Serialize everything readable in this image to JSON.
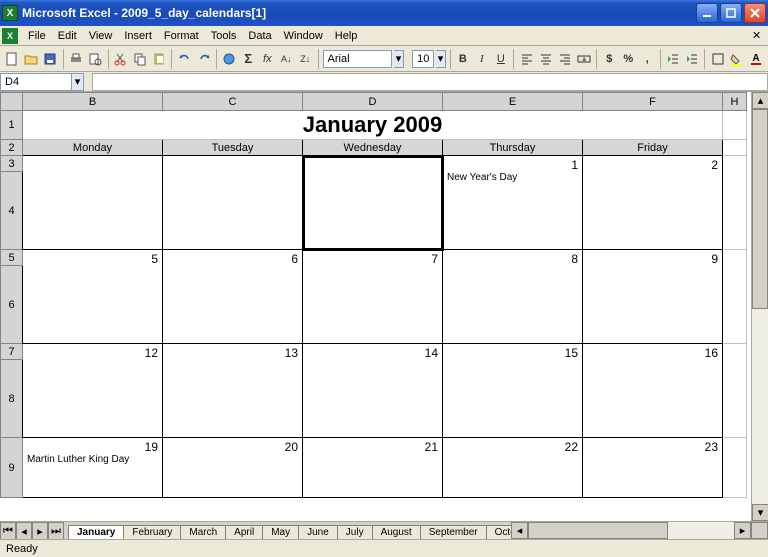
{
  "window": {
    "app_name": "Microsoft Excel",
    "doc_name": "2009_5_day_calendars[1]"
  },
  "menus": [
    "File",
    "Edit",
    "View",
    "Insert",
    "Format",
    "Tools",
    "Data",
    "Window",
    "Help"
  ],
  "toolbar": {
    "font_name": "Arial",
    "font_size": "10"
  },
  "formula": {
    "cell_ref": "D4"
  },
  "columns": [
    "B",
    "C",
    "D",
    "E",
    "F",
    "H"
  ],
  "calendar": {
    "title": "January 2009",
    "headers": [
      "Monday",
      "Tuesday",
      "Wednesday",
      "Thursday",
      "Friday"
    ],
    "weeks": [
      {
        "days": [
          {
            "num": "",
            "note": ""
          },
          {
            "num": "",
            "note": ""
          },
          {
            "num": "",
            "note": ""
          },
          {
            "num": "1",
            "note": "New Year's Day"
          },
          {
            "num": "2",
            "note": ""
          }
        ]
      },
      {
        "days": [
          {
            "num": "5",
            "note": ""
          },
          {
            "num": "6",
            "note": ""
          },
          {
            "num": "7",
            "note": ""
          },
          {
            "num": "8",
            "note": ""
          },
          {
            "num": "9",
            "note": ""
          }
        ]
      },
      {
        "days": [
          {
            "num": "12",
            "note": ""
          },
          {
            "num": "13",
            "note": ""
          },
          {
            "num": "14",
            "note": ""
          },
          {
            "num": "15",
            "note": ""
          },
          {
            "num": "16",
            "note": ""
          }
        ]
      },
      {
        "days": [
          {
            "num": "19",
            "note": "Martin Luther King Day"
          },
          {
            "num": "20",
            "note": ""
          },
          {
            "num": "21",
            "note": ""
          },
          {
            "num": "22",
            "note": ""
          },
          {
            "num": "23",
            "note": ""
          }
        ]
      }
    ]
  },
  "row_headers": [
    "1",
    "2",
    "3",
    "4",
    "5",
    "6",
    "7",
    "8",
    "9"
  ],
  "sheet_tabs": [
    "January",
    "February",
    "March",
    "April",
    "May",
    "June",
    "July",
    "August",
    "September",
    "October"
  ],
  "active_tab": "January",
  "status": "Ready"
}
